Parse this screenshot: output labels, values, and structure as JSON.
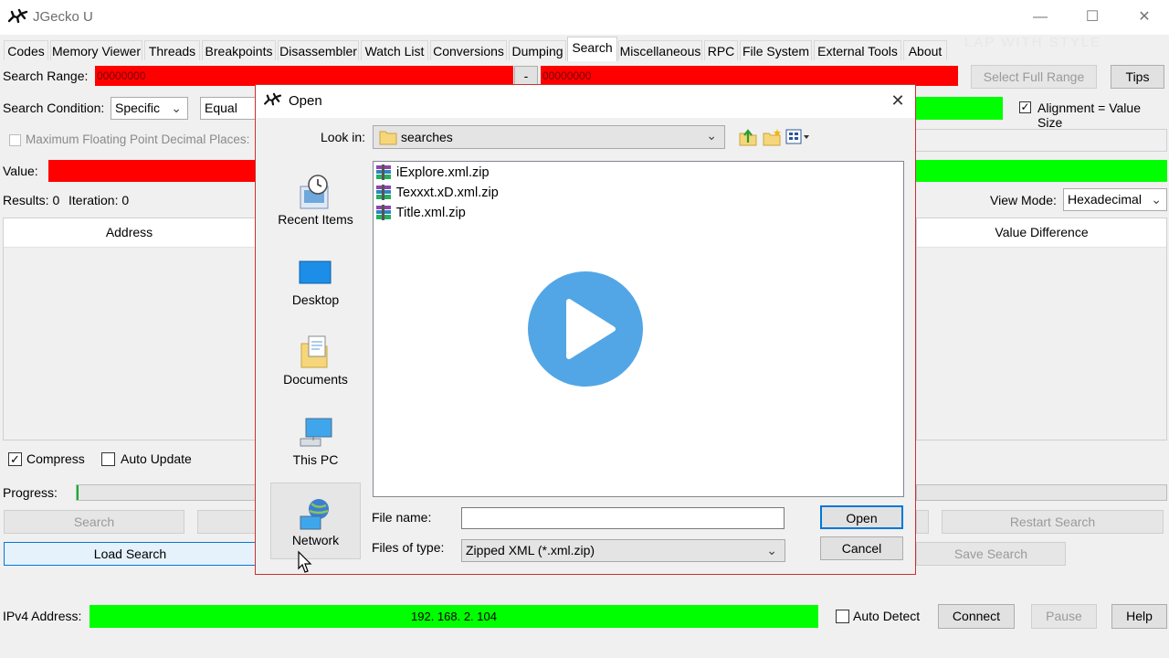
{
  "app": {
    "title": "JGecko U",
    "watermark": "LAP WITH STYLE"
  },
  "tabs": [
    {
      "label": "Codes"
    },
    {
      "label": "Memory Viewer"
    },
    {
      "label": "Threads"
    },
    {
      "label": "Breakpoints"
    },
    {
      "label": "Disassembler"
    },
    {
      "label": "Watch List"
    },
    {
      "label": "Conversions"
    },
    {
      "label": "Dumping"
    },
    {
      "label": "Search"
    },
    {
      "label": "Miscellaneous"
    },
    {
      "label": "RPC"
    },
    {
      "label": "File System"
    },
    {
      "label": "External Tools"
    },
    {
      "label": "About"
    }
  ],
  "search": {
    "range_label": "Search Range:",
    "range_start": "00000000",
    "range_sep": "-",
    "range_end": "00000000",
    "select_full_range": "Select Full Range",
    "tips": "Tips",
    "condition_label": "Search Condition:",
    "condition_type": "Specific",
    "condition_op": "Equal",
    "alignment_label": "Alignment = Value Size",
    "alignment_checked": true,
    "max_fp_label": "Maximum Floating Point Decimal Places:",
    "value_label": "Value:",
    "results_label": "Results: 0",
    "iteration_label": "Iteration: 0",
    "view_mode_label": "View Mode:",
    "view_mode_value": "Hexadecimal",
    "col_address": "Address",
    "col_value_diff": "Value Difference",
    "compress_label": "Compress",
    "compress_checked": true,
    "auto_update_label": "Auto Update",
    "auto_update_checked": false,
    "progress_label": "Progress:",
    "search_button": "Search",
    "restart_button": "Restart Search",
    "load_button": "Load Search",
    "save_button": "Save Search"
  },
  "footer": {
    "ipv4_label": "IPv4 Address:",
    "ip_value": "192. 168. 2. 104",
    "auto_detect_label": "Auto Detect",
    "connect": "Connect",
    "pause": "Pause",
    "help": "Help"
  },
  "dialog": {
    "title": "Open",
    "look_in_label": "Look in:",
    "look_in_value": "searches",
    "places": [
      {
        "label": "Recent Items",
        "icon": "recent-items-icon"
      },
      {
        "label": "Desktop",
        "icon": "desktop-icon"
      },
      {
        "label": "Documents",
        "icon": "documents-icon"
      },
      {
        "label": "This PC",
        "icon": "this-pc-icon"
      },
      {
        "label": "Network",
        "icon": "network-icon"
      }
    ],
    "files": [
      {
        "name": "iExplore.xml.zip"
      },
      {
        "name": "Texxxt.xD.xml.zip"
      },
      {
        "name": "Title.xml.zip"
      }
    ],
    "file_name_label": "File name:",
    "file_name_value": "",
    "files_of_type_label": "Files of type:",
    "files_of_type_value": "Zipped XML (*.xml.zip)",
    "open_button": "Open",
    "cancel_button": "Cancel"
  },
  "colors": {
    "red_field": "#ff0000",
    "green_field": "#00ff00",
    "play_button": "#52a6e6",
    "dialog_border": "#c93030"
  }
}
